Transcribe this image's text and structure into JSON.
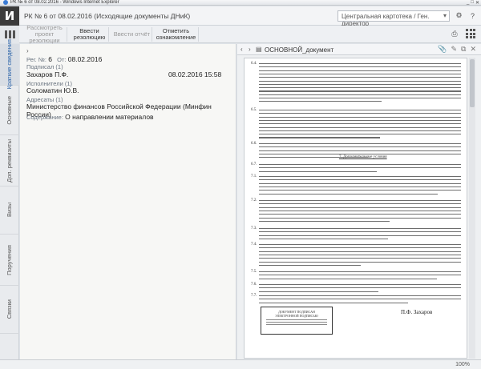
{
  "window": {
    "title": "РК № 6 от 08.02.2016 - Windows Internet Explorer"
  },
  "app": {
    "logo_letter": "И",
    "doc_title": "РК № 6 от 08.02.2016 (Исходящие документы ДНиК)",
    "dept_select": "Центральная картотека / Ген. директор"
  },
  "toolbar": {
    "buttons": [
      {
        "label": "Рассмотреть проект резолюции",
        "disabled": true
      },
      {
        "label": "Ввести резолюцию",
        "disabled": false
      },
      {
        "label": "Ввести отчёт",
        "disabled": true
      },
      {
        "label": "Отметить ознакомление",
        "disabled": false
      }
    ]
  },
  "leftnav": {
    "tabs": [
      "Краткие сведения",
      "Основные",
      "Доп. реквизиты",
      "Визы",
      "Поручения",
      "Связки"
    ]
  },
  "card": {
    "reg_label": "Рег. №:",
    "reg_num": "6",
    "date_label": "От:",
    "date": "08.02.2016",
    "signers_label": "Подписал (1)",
    "signer": "Захаров П.Ф.",
    "signed_at": "08.02.2016 15:58",
    "executors_label": "Исполнители (1)",
    "executor": "Соломатин Ю.В.",
    "addressees_label": "Адресаты (1)",
    "addressee": "Министерство финансов Российской Федерации (Минфин России)",
    "content_label": "Содержание:",
    "content": "О направлении материалов"
  },
  "viewer": {
    "file_name": "ОСНОВНОЙ_документ",
    "section_heading": "7. Дополнительные условия",
    "paragraph_numbers": [
      "6.4.",
      "6.5.",
      "6.6.",
      "6.7.",
      "7.1.",
      "7.2.",
      "7.3.",
      "7.4.",
      "7.5.",
      "7.6.",
      "7.7."
    ],
    "stamp_lines": [
      "ДОКУМЕНТ ПОДПИСАН",
      "ЭЛЕКТРОННОЙ ПОДПИСЬЮ"
    ],
    "signer_name": "П.Ф. Захаров"
  },
  "status": {
    "zoom": "100%"
  }
}
